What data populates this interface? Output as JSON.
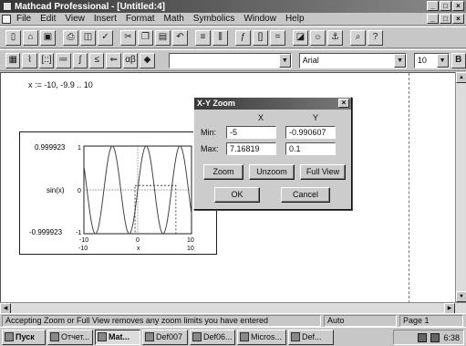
{
  "window": {
    "title": "Mathcad Professional - [Untitled:4]"
  },
  "menubar": {
    "items": [
      "File",
      "Edit",
      "View",
      "Insert",
      "Format",
      "Math",
      "Symbolics",
      "Window",
      "Help"
    ]
  },
  "toolbar2": {
    "style_value": "",
    "font_value": "Arial",
    "size_value": "10"
  },
  "worksheet": {
    "range_definition": "x := -10, -9.9 .. 10"
  },
  "plot": {
    "y_top_label": "0.999923",
    "y_axis_label": "sin(x)",
    "y_bottom_label": "-0.999923",
    "y_tick_top": "1",
    "y_tick_mid": "0",
    "y_tick_bottom": "-1",
    "x_tick_left": "-10",
    "x_tick_mid": "0",
    "x_tick_right": "10",
    "x_bottom_left": "-10",
    "x_axis_label": "x",
    "x_bottom_right": "10",
    "zoom_box": {
      "x_min": -0.5,
      "x_max": 7.1,
      "y_min": -1,
      "y_max": 0.1
    }
  },
  "chart_data": {
    "type": "line",
    "series": [
      {
        "name": "sin(x)",
        "function": "sin(x)"
      }
    ],
    "xlabel": "x",
    "ylabel": "sin(x)",
    "xlim": [
      -10,
      10
    ],
    "ylim": [
      -1,
      1
    ],
    "y_display_limits": [
      "0.999923",
      "-0.999923"
    ],
    "x_tick_labels": [
      "-10",
      "0",
      "10"
    ],
    "y_tick_labels": [
      "1",
      "0",
      "-1"
    ]
  },
  "dialog": {
    "title": "X-Y Zoom",
    "col_x": "X",
    "col_y": "Y",
    "min_label": "Min:",
    "max_label": "Max:",
    "x_min": "-5",
    "y_min": "-0.990607",
    "x_max": "7.16819",
    "y_max": "0.1",
    "zoom_btn": "Zoom",
    "unzoom_btn": "Unzoom",
    "fullview_btn": "Full View",
    "ok_btn": "OK",
    "cancel_btn": "Cancel"
  },
  "status": {
    "message": "Accepting Zoom or Full View removes any zoom limits you have entered",
    "mode": "Auto",
    "page": "Page 1"
  },
  "taskbar": {
    "start": "Пуск",
    "items": [
      "Отчет...",
      "Mat...",
      "Def007",
      "Def06...",
      "Micros...",
      "Def..."
    ],
    "clock": "6:38"
  },
  "colors": {
    "chrome": "#c4c4c4",
    "titlebar": "#3a3a3a",
    "worksheet": "#fbfbfb",
    "curve": "#444444"
  }
}
